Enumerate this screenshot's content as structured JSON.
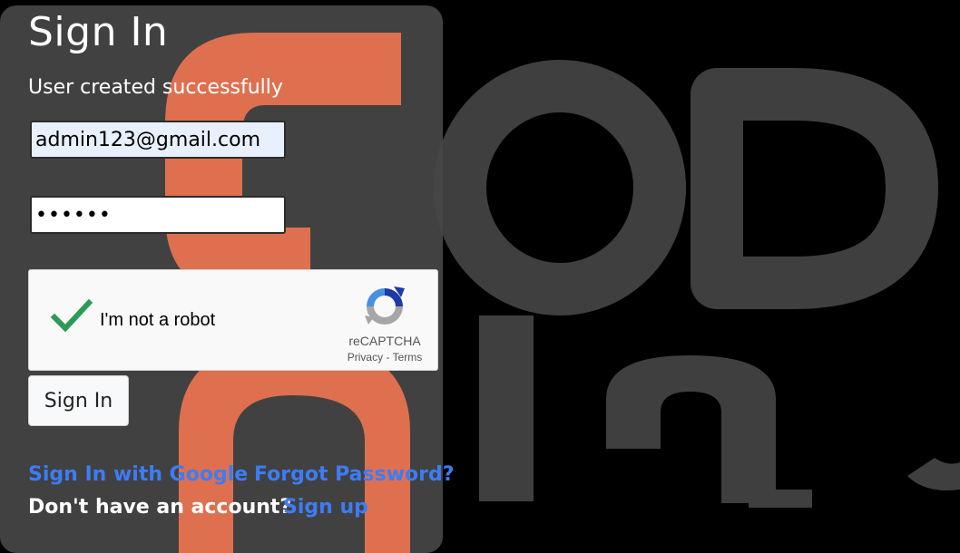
{
  "signin": {
    "title": "Sign In",
    "status_message": "User created successfully",
    "email_value": "admin123@gmail.com",
    "password_value": "••••••",
    "submit_label": "Sign In"
  },
  "recaptcha": {
    "checkbox_label": "I'm not a robot",
    "checked": true,
    "brand": "reCAPTCHA",
    "privacy": "Privacy",
    "separator": " - ",
    "terms": "Terms"
  },
  "links": {
    "google": "Sign In with Google",
    "forgot_password": "Forgot Password?",
    "no_account": "Don't have an account?",
    "signup": "Sign up"
  },
  "colors": {
    "link": "#3d7cf5",
    "card_bg": "#464646",
    "accent_orange": "#ef7651",
    "page_bg": "#000000",
    "check_green": "#2e9a58"
  },
  "icons": {
    "check": "check-icon",
    "recaptcha_logo": "recaptcha-logo-icon"
  }
}
